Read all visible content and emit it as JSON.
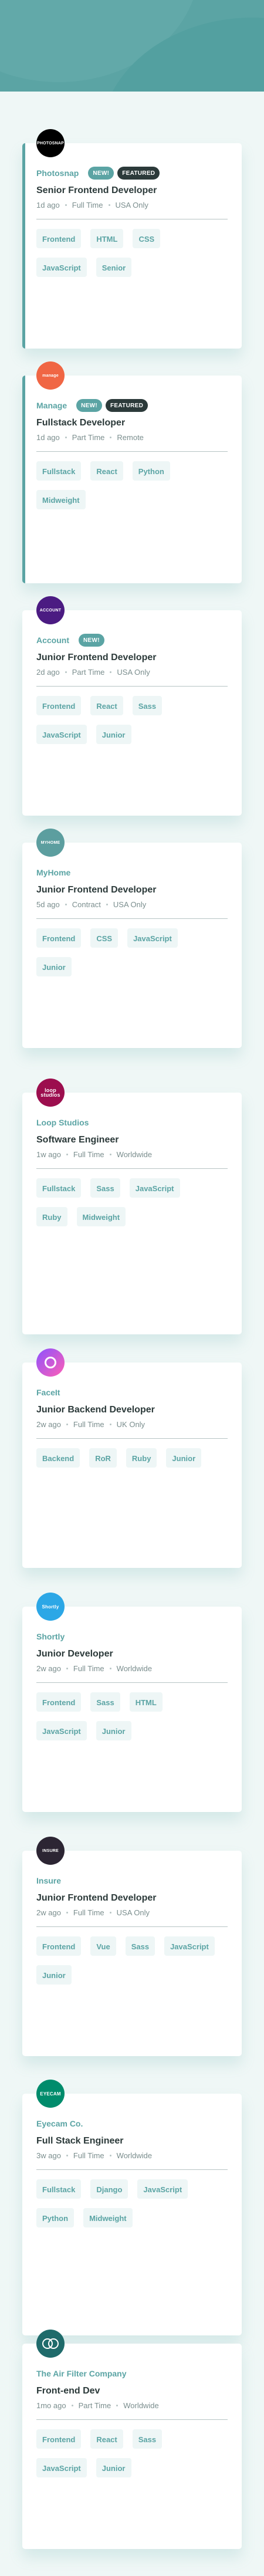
{
  "jobs": [
    {
      "company": "Photosnap",
      "logo_text": "PHOTOSNAP",
      "new": true,
      "featured": true,
      "position": "Senior Frontend Developer",
      "posted": "1d ago",
      "contract": "Full Time",
      "location": "USA Only",
      "tags": [
        "Frontend",
        "HTML",
        "CSS",
        "JavaScript",
        "Senior"
      ]
    },
    {
      "company": "Manage",
      "logo_text": "manage",
      "new": true,
      "featured": true,
      "position": "Fullstack Developer",
      "posted": "1d ago",
      "contract": "Part Time",
      "location": "Remote",
      "tags": [
        "Fullstack",
        "React",
        "Python",
        "Midweight"
      ]
    },
    {
      "company": "Account",
      "logo_text": "ACCOUNT",
      "new": true,
      "featured": false,
      "position": "Junior Frontend Developer",
      "posted": "2d ago",
      "contract": "Part Time",
      "location": "USA Only",
      "tags": [
        "Frontend",
        "React",
        "Sass",
        "JavaScript",
        "Junior"
      ]
    },
    {
      "company": "MyHome",
      "logo_text": "MYHOME",
      "new": false,
      "featured": false,
      "position": "Junior Frontend Developer",
      "posted": "5d ago",
      "contract": "Contract",
      "location": "USA Only",
      "tags": [
        "Frontend",
        "CSS",
        "JavaScript",
        "Junior"
      ]
    },
    {
      "company": "Loop Studios",
      "logo_text": "loop studios",
      "new": false,
      "featured": false,
      "position": "Software Engineer",
      "posted": "1w ago",
      "contract": "Full Time",
      "location": "Worldwide",
      "tags": [
        "Fullstack",
        "Sass",
        "JavaScript",
        "Ruby",
        "Midweight"
      ]
    },
    {
      "company": "FaceIt",
      "logo_text": "",
      "new": false,
      "featured": false,
      "position": "Junior Backend Developer",
      "posted": "2w ago",
      "contract": "Full Time",
      "location": "UK Only",
      "tags": [
        "Backend",
        "RoR",
        "Ruby",
        "Junior"
      ]
    },
    {
      "company": "Shortly",
      "logo_text": "Shortly",
      "new": false,
      "featured": false,
      "position": "Junior Developer",
      "posted": "2w ago",
      "contract": "Full Time",
      "location": "Worldwide",
      "tags": [
        "Frontend",
        "Sass",
        "HTML",
        "JavaScript",
        "Junior"
      ]
    },
    {
      "company": "Insure",
      "logo_text": "INSURE",
      "new": false,
      "featured": false,
      "position": "Junior Frontend Developer",
      "posted": "2w ago",
      "contract": "Full Time",
      "location": "USA Only",
      "tags": [
        "Frontend",
        "Vue",
        "Sass",
        "JavaScript",
        "Junior"
      ]
    },
    {
      "company": "Eyecam Co.",
      "logo_text": "EYECAM",
      "new": false,
      "featured": false,
      "position": "Full Stack Engineer",
      "posted": "3w ago",
      "contract": "Full Time",
      "location": "Worldwide",
      "tags": [
        "Fullstack",
        "Django",
        "JavaScript",
        "Python",
        "Midweight"
      ]
    },
    {
      "company": "The Air Filter Company",
      "logo_text": "",
      "new": false,
      "featured": false,
      "position": "Front-end Dev",
      "posted": "1mo ago",
      "contract": "Part Time",
      "location": "Worldwide",
      "tags": [
        "Frontend",
        "React",
        "Sass",
        "JavaScript",
        "Junior"
      ]
    }
  ],
  "labels": {
    "new": "NEW!",
    "featured": "FEATURED"
  },
  "colors": {
    "primary": "#5ba4a4",
    "dark": "#2c3a3a",
    "background": "#eff7f6",
    "tag_bg": "#eef6f6"
  }
}
